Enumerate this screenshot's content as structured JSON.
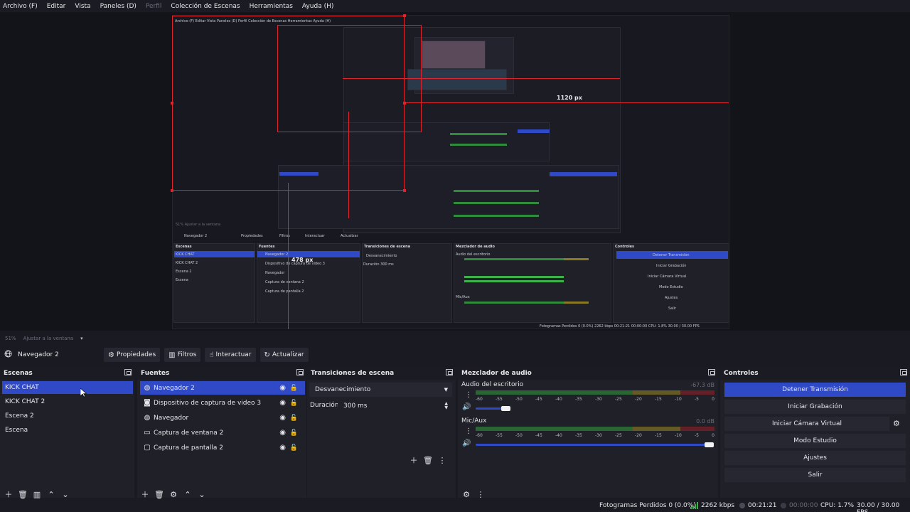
{
  "menu": [
    {
      "label": "Archivo (F)",
      "enabled": true
    },
    {
      "label": "Editar",
      "enabled": true
    },
    {
      "label": "Vista",
      "enabled": true
    },
    {
      "label": "Paneles (D)",
      "enabled": true
    },
    {
      "label": "Perfil",
      "enabled": false
    },
    {
      "label": "Colección de Escenas",
      "enabled": true
    },
    {
      "label": "Herramientas",
      "enabled": true
    },
    {
      "label": "Ayuda (H)",
      "enabled": true
    }
  ],
  "preview": {
    "measure_labels": [
      "1120 px",
      "478 px"
    ],
    "nested_texts": {
      "menu": "Archivo (F)   Editar   Vista   Paneles (D)   Perfil   Colección de Escenas   Herramientas   Ayuda (H)",
      "zoom": "51%   Ajustar a la ventana",
      "source_name": "Navegador 2",
      "toolbar": [
        "Propiedades",
        "Filtros",
        "Interactuar",
        "Actualizar"
      ],
      "docks": [
        "Escenas",
        "Fuentes",
        "Transiciones de escena",
        "Mezclador de audio",
        "Controles"
      ],
      "scenes": [
        "KICK CHAT",
        "KICK CHAT 2",
        "Escena 2",
        "Escena"
      ],
      "sources": [
        "Navegador 2",
        "Dispositivo de captura de video 3",
        "Navegador",
        "Captura de ventana 2",
        "Captura de pantalla 2"
      ],
      "transition": "Desvanecimiento",
      "duration": "Duración    300 ms",
      "mixer": [
        "Audio del escritorio",
        "Mic/Aux"
      ],
      "controls": [
        "Detener Transmisión",
        "Iniciar Grabación",
        "Iniciar Cámara Virtual",
        "Modo Estudio",
        "Ajustes",
        "Salir"
      ],
      "status": "Fotogramas Perdidos 0 (0.0%)    2262 kbps    00:21:21    00:00:00    CPU: 1.8%    30.00 / 30.00 FPS"
    }
  },
  "zoom": {
    "percent": "51%",
    "fit": "Ajustar a la ventana"
  },
  "source_toolbar": {
    "source_name": "Navegador 2",
    "properties": "Propiedades",
    "filters": "Filtros",
    "interact": "Interactuar",
    "refresh": "Actualizar"
  },
  "scenes": {
    "title": "Escenas",
    "items": [
      "KICK CHAT",
      "KICK CHAT 2",
      "Escena 2",
      "Escena"
    ],
    "selected": 0
  },
  "sources": {
    "title": "Fuentes",
    "items": [
      {
        "label": "Navegador 2",
        "icon": "globe-icon"
      },
      {
        "label": "Dispositivo de captura de video 3",
        "icon": "camera-icon"
      },
      {
        "label": "Navegador",
        "icon": "globe-icon"
      },
      {
        "label": "Captura de ventana 2",
        "icon": "window-icon"
      },
      {
        "label": "Captura de pantalla 2",
        "icon": "monitor-icon"
      }
    ],
    "selected": 0
  },
  "transitions": {
    "title": "Transiciones de escena",
    "selected": "Desvanecimiento",
    "duration_label": "Duración",
    "duration_value": "300 ms"
  },
  "mixer": {
    "title": "Mezclador de audio",
    "channels": [
      {
        "name": "Audio del escritorio",
        "db": "-67.3 dB",
        "volume": 0.2
      },
      {
        "name": "Mic/Aux",
        "db": "0.0 dB",
        "volume": 1.0
      }
    ],
    "ticks": [
      "-60",
      "-55",
      "-50",
      "-45",
      "-40",
      "-35",
      "-30",
      "-25",
      "-20",
      "-15",
      "-10",
      "-5",
      "0"
    ]
  },
  "controls": {
    "title": "Controles",
    "stop_stream": "Detener Transmisión",
    "start_recording": "Iniciar Grabación",
    "start_virtual_cam": "Iniciar Cámara Virtual",
    "studio_mode": "Modo Estudio",
    "settings": "Ajustes",
    "exit": "Salir"
  },
  "status": {
    "dropped_frames": "Fotogramas Perdidos 0 (0.0%)",
    "bitrate": "2262 kbps",
    "stream_time": "00:21:21",
    "rec_time": "00:00:00",
    "cpu": "CPU: 1.7%",
    "fps": "30.00 / 30.00 FPS"
  },
  "colors": {
    "accent": "#2f49c7",
    "measure_red": "#e0242e",
    "meter_green": "#2f8c3a",
    "meter_yellow": "#8a7a24",
    "meter_red": "#8c2026"
  }
}
